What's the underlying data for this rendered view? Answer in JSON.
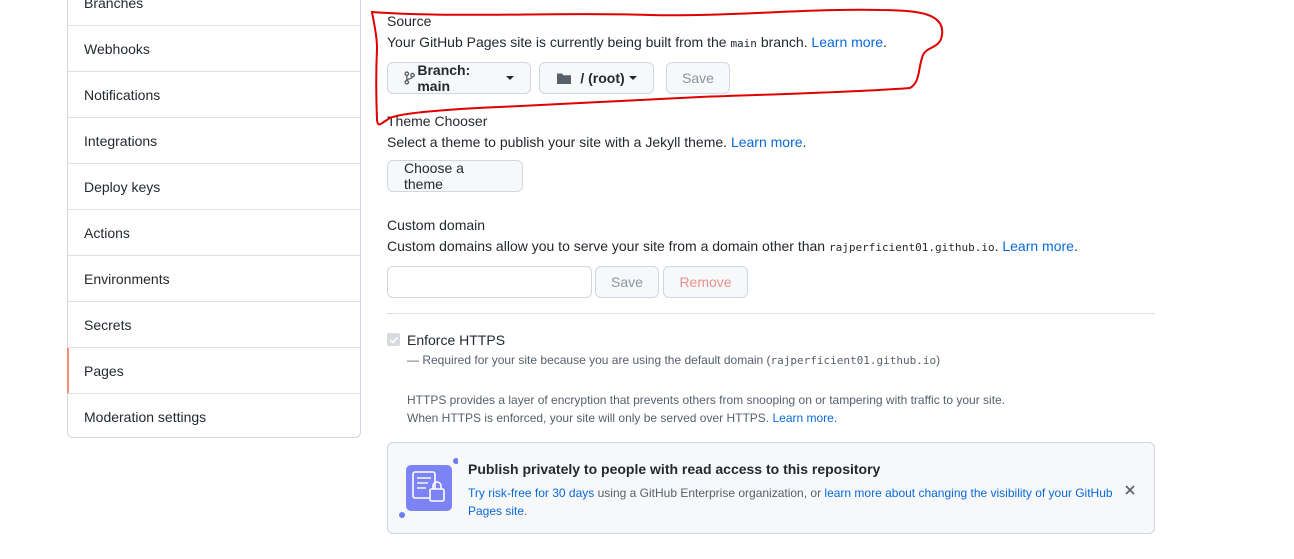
{
  "sidebar": {
    "items": [
      {
        "label": "Branches"
      },
      {
        "label": "Webhooks"
      },
      {
        "label": "Notifications"
      },
      {
        "label": "Integrations"
      },
      {
        "label": "Deploy keys"
      },
      {
        "label": "Actions"
      },
      {
        "label": "Environments"
      },
      {
        "label": "Secrets"
      },
      {
        "label": "Pages",
        "selected": true
      },
      {
        "label": "Moderation settings"
      }
    ]
  },
  "source": {
    "heading": "Source",
    "desc_prefix": "Your GitHub Pages site is currently being built from the",
    "branch_code": "main",
    "desc_suffix": "branch.",
    "learn_more": "Learn more",
    "branch_button": "Branch: main",
    "folder_button": "/ (root)",
    "save_button": "Save"
  },
  "theme": {
    "heading": "Theme Chooser",
    "desc": "Select a theme to publish your site with a Jekyll theme.",
    "learn_more": "Learn more",
    "button": "Choose a theme"
  },
  "custom_domain": {
    "heading": "Custom domain",
    "desc": "Custom domains allow you to serve your site from a domain other than",
    "domain_code": "rajperficient01.github.io",
    "learn_more": "Learn more",
    "input_value": "",
    "save_button": "Save",
    "remove_button": "Remove"
  },
  "https": {
    "label": "Enforce HTTPS",
    "checked": true,
    "required_note": "— Required for your site because you are using the default domain (",
    "domain_code": "rajperficient01.github.io",
    "required_close": ")",
    "info_line1": "HTTPS provides a layer of encryption that prevents others from snooping on or tampering with traffic to your site.",
    "info_line2": "When HTTPS is enforced, your site will only be served over HTTPS.",
    "learn_more": "Learn more."
  },
  "banner": {
    "title": "Publish privately to people with read access to this repository",
    "try_link": "Try risk-free for 30 days",
    "middle_text": "using a GitHub Enterprise organization, or",
    "learn_link": "learn more about changing the visibility of your GitHub Pages site",
    "end": ".",
    "close_icon": "close-icon"
  },
  "annotation": {
    "color": "#e00000"
  }
}
